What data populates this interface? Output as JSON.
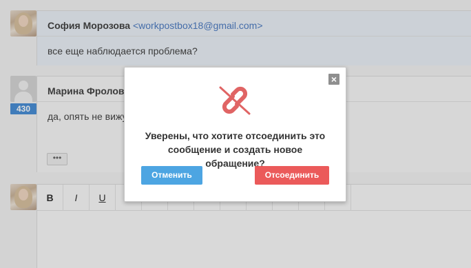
{
  "messages": [
    {
      "sender_name": "София Морозова",
      "sender_email": "<workpostbox18@gmail.com>",
      "text": "все еще наблюдается проблема?"
    },
    {
      "sender_name": "Марина Фролова",
      "badge": "430",
      "text": "да, опять не вижу",
      "more_label": "•••"
    }
  ],
  "editor": {
    "toolbar": {
      "bold": "B",
      "italic": "I",
      "underline": "U"
    }
  },
  "modal": {
    "close_label": "×",
    "question_line1": "Уверены, что хотите отсоединить это",
    "question_line2": "сообщение и создать новое обращение?",
    "cancel_label": "Отменить",
    "confirm_label": "Отсоединить",
    "icon": "unlink-icon",
    "icon_color": "#e06464",
    "cancel_color": "#4da5e2",
    "confirm_color": "#eb5a5a"
  }
}
